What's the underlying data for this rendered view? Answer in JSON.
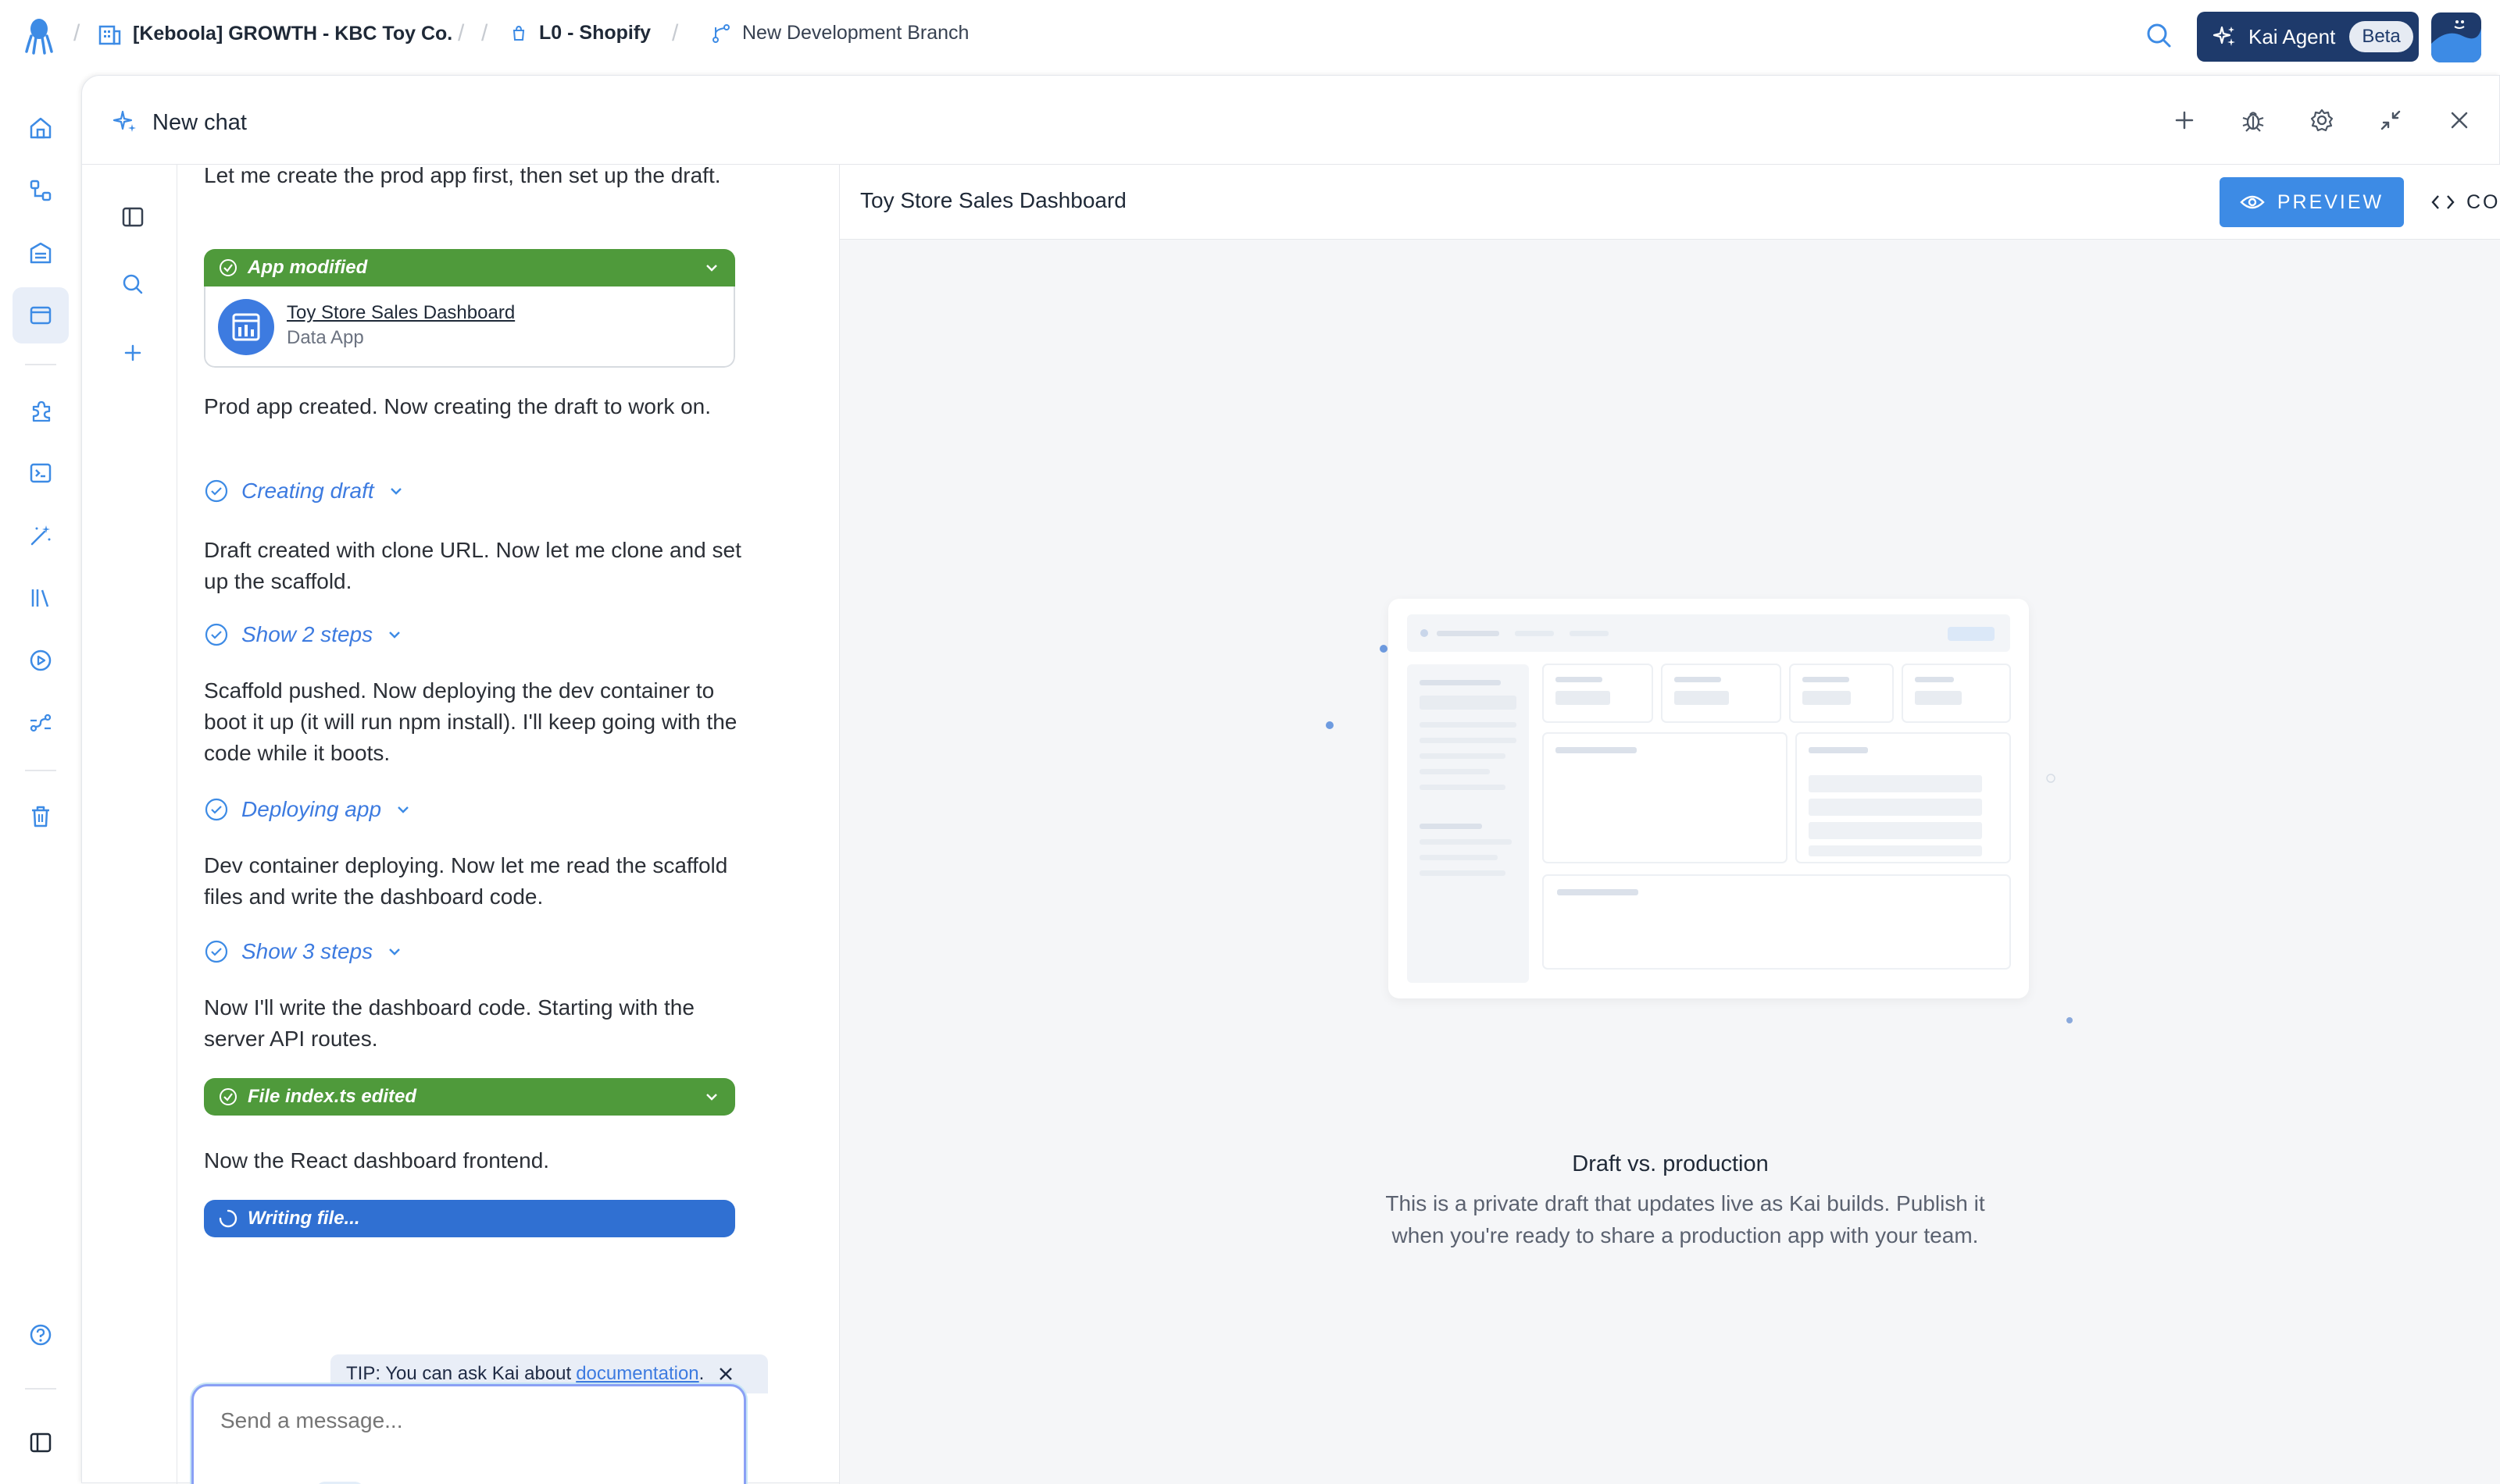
{
  "topbar": {
    "project": "[Keboola] GROWTH - KBC Toy Co.",
    "connection": "L0 - Shopify",
    "branch": "New Development Branch",
    "kai_label": "Kai Agent",
    "beta_label": "Beta"
  },
  "panel": {
    "title": "New chat"
  },
  "chat": {
    "messages": {
      "m1": "Let me create the prod app first, then set up the draft.",
      "m2": "Prod app created. Now creating the draft to work on.",
      "m3": "Draft created with clone URL. Now let me clone and set up the scaffold.",
      "m4": "Scaffold pushed. Now deploying the dev container to boot it up (it will run npm install). I'll keep going with the code while it boots.",
      "m5": "Dev container deploying. Now let me read the scaffold files and write the dashboard code.",
      "m6": "Now I'll write the dashboard code. Starting with the server API routes.",
      "m7": "Now the React dashboard frontend."
    },
    "app_card": {
      "status": "App modified",
      "name": "Toy Store Sales Dashboard",
      "type": "Data App"
    },
    "steps": {
      "s1": "Creating draft",
      "s2": "Show 2 steps",
      "s3": "Deploying app",
      "s4": "Show 3 steps"
    },
    "file_status": "File index.ts edited",
    "writing_status": "Writing file...",
    "tip": {
      "prefix": "TIP: You can ask Kai about",
      "link": "documentation",
      "suffix": "."
    },
    "composer": {
      "placeholder": "Send a message..."
    }
  },
  "preview": {
    "title": "Toy Store Sales Dashboard",
    "preview_label": "PREVIEW",
    "code_label": "CODE",
    "empty_title": "Draft vs. production",
    "empty_text": "This is a private draft that updates live as Kai builds. Publish it when you're ready to share a production app with your team."
  },
  "colors": {
    "accent": "#3d8be5",
    "success": "#4f9a3b",
    "progress": "#3070d2",
    "brand_dark": "#1e3a6b"
  }
}
